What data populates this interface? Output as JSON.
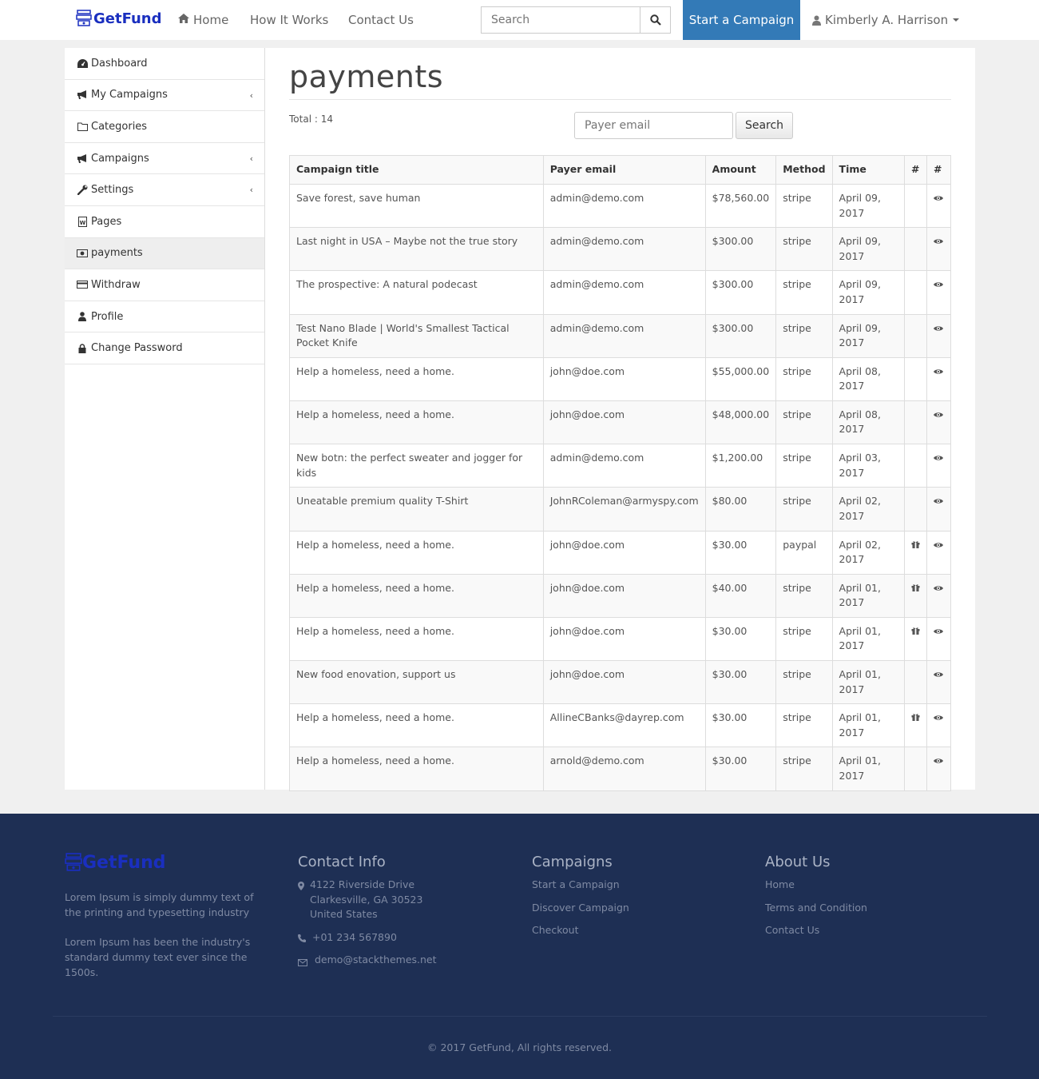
{
  "brand": {
    "name": "GetFund",
    "color": "#1a2fbf"
  },
  "navbar": {
    "home": "Home",
    "how_it_works": "How It Works",
    "contact_us": "Contact Us",
    "search_placeholder": "Search",
    "start_campaign": "Start a Campaign",
    "user_name": "Kimberly A. Harrison",
    "accent": "#337ab7"
  },
  "sidebar": {
    "items": [
      {
        "label": "Dashboard",
        "icon": "dashboard-icon"
      },
      {
        "label": "My Campaigns",
        "icon": "bullhorn-icon",
        "chevron": true
      },
      {
        "label": "Categories",
        "icon": "folder-icon"
      },
      {
        "label": "Campaigns",
        "icon": "bullhorn-icon",
        "chevron": true
      },
      {
        "label": "Settings",
        "icon": "wrench-icon",
        "chevron": true
      },
      {
        "label": "Pages",
        "icon": "wordpress-icon"
      },
      {
        "label": "payments",
        "icon": "money-icon",
        "active": true
      },
      {
        "label": "Withdraw",
        "icon": "credit-card-icon"
      },
      {
        "label": "Profile",
        "icon": "user-icon"
      },
      {
        "label": "Change Password",
        "icon": "lock-icon"
      }
    ]
  },
  "main": {
    "title": "payments",
    "total_label": "Total : 14",
    "payer_placeholder": "Payer email",
    "search_button": "Search",
    "columns": [
      "Campaign title",
      "Payer email",
      "Amount",
      "Method",
      "Time",
      "#",
      "#"
    ],
    "rows": [
      {
        "title": "Save forest, save human",
        "email": "admin@demo.com",
        "amount": "$78,560.00",
        "method": "stripe",
        "time": "April 09, 2017",
        "gift": false
      },
      {
        "title": "Last night in USA – Maybe not the true story",
        "email": "admin@demo.com",
        "amount": "$300.00",
        "method": "stripe",
        "time": "April 09, 2017",
        "gift": false
      },
      {
        "title": "The prospective: A natural podecast",
        "email": "admin@demo.com",
        "amount": "$300.00",
        "method": "stripe",
        "time": "April 09, 2017",
        "gift": false
      },
      {
        "title": "Test Nano Blade | World's Smallest Tactical Pocket Knife",
        "email": "admin@demo.com",
        "amount": "$300.00",
        "method": "stripe",
        "time": "April 09, 2017",
        "gift": false
      },
      {
        "title": "Help a homeless, need a home.",
        "email": "john@doe.com",
        "amount": "$55,000.00",
        "method": "stripe",
        "time": "April 08, 2017",
        "gift": false
      },
      {
        "title": "Help a homeless, need a home.",
        "email": "john@doe.com",
        "amount": "$48,000.00",
        "method": "stripe",
        "time": "April 08, 2017",
        "gift": false
      },
      {
        "title": "New botn: the perfect sweater and jogger for kids",
        "email": "admin@demo.com",
        "amount": "$1,200.00",
        "method": "stripe",
        "time": "April 03, 2017",
        "gift": false
      },
      {
        "title": "Uneatable premium quality T-Shirt",
        "email": "JohnRColeman@armyspy.com",
        "amount": "$80.00",
        "method": "stripe",
        "time": "April 02, 2017",
        "gift": false
      },
      {
        "title": "Help a homeless, need a home.",
        "email": "john@doe.com",
        "amount": "$30.00",
        "method": "paypal",
        "time": "April 02, 2017",
        "gift": true
      },
      {
        "title": "Help a homeless, need a home.",
        "email": "john@doe.com",
        "amount": "$40.00",
        "method": "stripe",
        "time": "April 01, 2017",
        "gift": true
      },
      {
        "title": "Help a homeless, need a home.",
        "email": "john@doe.com",
        "amount": "$30.00",
        "method": "stripe",
        "time": "April 01, 2017",
        "gift": true
      },
      {
        "title": "New food enovation, support us",
        "email": "john@doe.com",
        "amount": "$30.00",
        "method": "stripe",
        "time": "April 01, 2017",
        "gift": false
      },
      {
        "title": "Help a homeless, need a home.",
        "email": "AllineCBanks@dayrep.com",
        "amount": "$30.00",
        "method": "stripe",
        "time": "April 01, 2017",
        "gift": true
      },
      {
        "title": "Help a homeless, need a home.",
        "email": "arnold@demo.com",
        "amount": "$30.00",
        "method": "stripe",
        "time": "April 01, 2017",
        "gift": false
      }
    ]
  },
  "footer": {
    "about_text_1": "Lorem Ipsum is simply dummy text of the printing and typesetting industry",
    "about_text_2": "Lorem Ipsum has been the industry's standard dummy text ever since the 1500s.",
    "contact_heading": "Contact Info",
    "address_line_1": "4122 Riverside Drive",
    "address_line_2": "Clarkesville, GA 30523",
    "address_line_3": "United States",
    "phone": "+01 234 567890",
    "email": "demo@stackthemes.net",
    "campaigns_heading": "Campaigns",
    "campaign_links": [
      "Start a Campaign",
      "Discover Campaign",
      "Checkout"
    ],
    "about_heading": "About Us",
    "about_links": [
      "Home",
      "Terms and Condition",
      "Contact Us"
    ],
    "copyright": "© 2017 GetFund, All rights reserved.",
    "bg": "#1e2f54"
  }
}
